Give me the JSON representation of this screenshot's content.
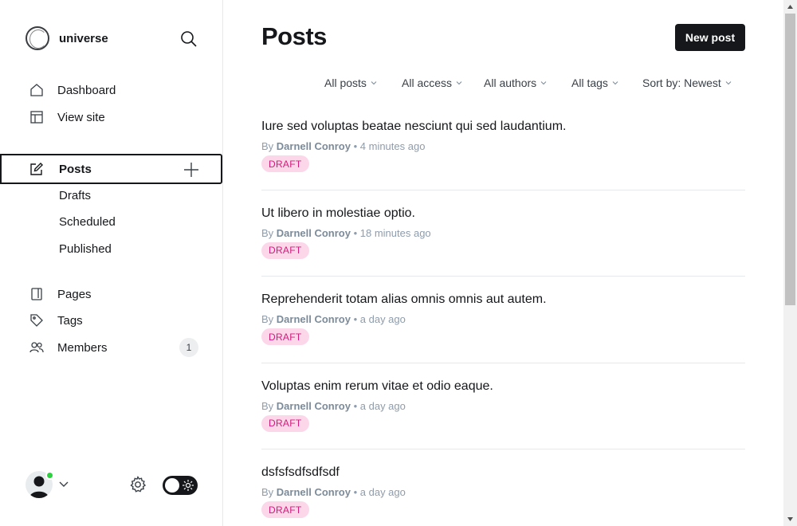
{
  "brand": {
    "name": "universe"
  },
  "nav": {
    "dashboard": "Dashboard",
    "view_site": "View site",
    "posts": "Posts",
    "drafts": "Drafts",
    "scheduled": "Scheduled",
    "published": "Published",
    "pages": "Pages",
    "tags": "Tags",
    "members": "Members",
    "members_count": "1"
  },
  "header": {
    "title": "Posts",
    "new_post": "New post"
  },
  "filters": {
    "type": "All posts",
    "access": "All access",
    "authors": "All authors",
    "tags": "All tags",
    "sort": "Sort by: Newest"
  },
  "posts": [
    {
      "title": "Iure sed voluptas beatae nesciunt qui sed laudantium.",
      "by": "By",
      "author": "Darnell Conroy",
      "time": "• 4 minutes ago",
      "status": "DRAFT"
    },
    {
      "title": "Ut libero in molestiae optio.",
      "by": "By",
      "author": "Darnell Conroy",
      "time": "• 18 minutes ago",
      "status": "DRAFT"
    },
    {
      "title": "Reprehenderit totam alias omnis omnis aut autem.",
      "by": "By",
      "author": "Darnell Conroy",
      "time": "• a day ago",
      "status": "DRAFT"
    },
    {
      "title": "Voluptas enim rerum vitae et odio eaque.",
      "by": "By",
      "author": "Darnell Conroy",
      "time": "• a day ago",
      "status": "DRAFT"
    },
    {
      "title": "dsfsfsdfsdfsdf",
      "by": "By",
      "author": "Darnell Conroy",
      "time": "• a day ago",
      "status": "DRAFT"
    }
  ],
  "colors": {
    "accent_dark": "#15171a",
    "draft_bg": "#fcd7ea",
    "draft_text": "#d01c7a",
    "online": "#30cf43"
  },
  "icons": {
    "search": "search-icon",
    "dashboard": "home-icon",
    "view_site": "layout-icon",
    "posts": "edit-icon",
    "add": "plus-icon",
    "pages": "page-icon",
    "tags": "tag-icon",
    "members": "members-icon",
    "settings": "gear-icon",
    "theme": "sun-icon"
  }
}
